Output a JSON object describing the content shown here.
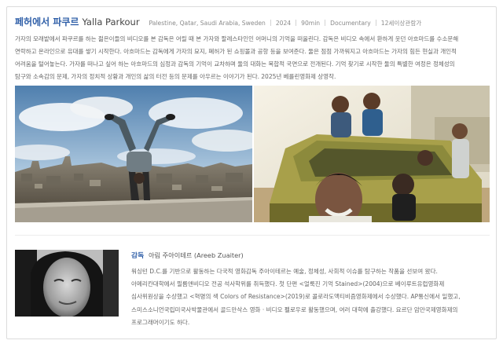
{
  "film": {
    "title_ko": "페허에서 파쿠르",
    "title_en": "Yalla Parkour",
    "meta": [
      "Palestine, Qatar, Saudi Arabia, Sweden",
      "2024",
      "90min",
      "Documentary",
      "12세이상관람가"
    ]
  },
  "synopsis_lines": [
    "가자의 모래밭에서 파쿠르를 하는 젊은이들의 비디오를 본 감독은 어릴 때 본 가자와 팔레스타인인 어머니의 기억을 떠올린다. 감독은 비디오 속에서 환하게 웃던 아흐마드를 수소문해",
    "연락하고 온라인으로 유대를 쌓기 시작한다. 아흐마드는 감독에게 가자의 묘지, 폐허가 된 쇼핑몰과 공항 등을 보여준다. 둘은 점점 가까워지고 아흐마드는 가자의 힘든 현실과 개인적",
    "어려움을 털어놓는다. 가자를 떠나고 싶어 하는 아흐마드의 심정과 감독의 기억이 교차하며 둘의 대화는 복합적 국면으로 전개된다. 기억 찾기로 시작한 둘의 특별한 여정은 정체성의",
    "탐구와 소속감의 문제, 가자의 정치적 상황과 개인의 삶의 터전 등의 문제를 아우르는 이야기가 된다. 2025년 베를린영화제 상영작."
  ],
  "director": {
    "role": "감독",
    "name": "아림 주아이테르 (Areeb Zuaiter)",
    "bio_lines": [
      "워싱턴 D.C.를 기반으로 활동하는 다국적 영화감독 주아이테르는 예술, 정체성, 사회적 이슈를 탐구하는 작품을 선보여 왔다.",
      "아메리칸대학에서 필름앤비디오 전공 석사학위를 취득했다. 첫 단편 <얼룩진 기억 Stained>(2004)으로 베이루트유럽영화제",
      "심사위원상을 수상했고 <혁명의 색 Colors of Resistance>(2019)로 콜로라도액티비즘영화제에서 수상했다. AP통신에서 일했고,",
      "스미스소니언국립미국사박물관에서 골드만삭스 영화 · 비디오 펠로우로 활동했으며, 여러 대학에 출강했다. 요르단 암만국제영화제의",
      "프로그래머이기도 하다."
    ]
  },
  "images": [
    {
      "name": "handstand-rooftop-still",
      "description": "man doing handstand on rooftop over city"
    },
    {
      "name": "group-selfie-car-still",
      "description": "young men posing around an abandoned car"
    },
    {
      "name": "director-portrait",
      "description": "black and white portrait of director"
    }
  ]
}
